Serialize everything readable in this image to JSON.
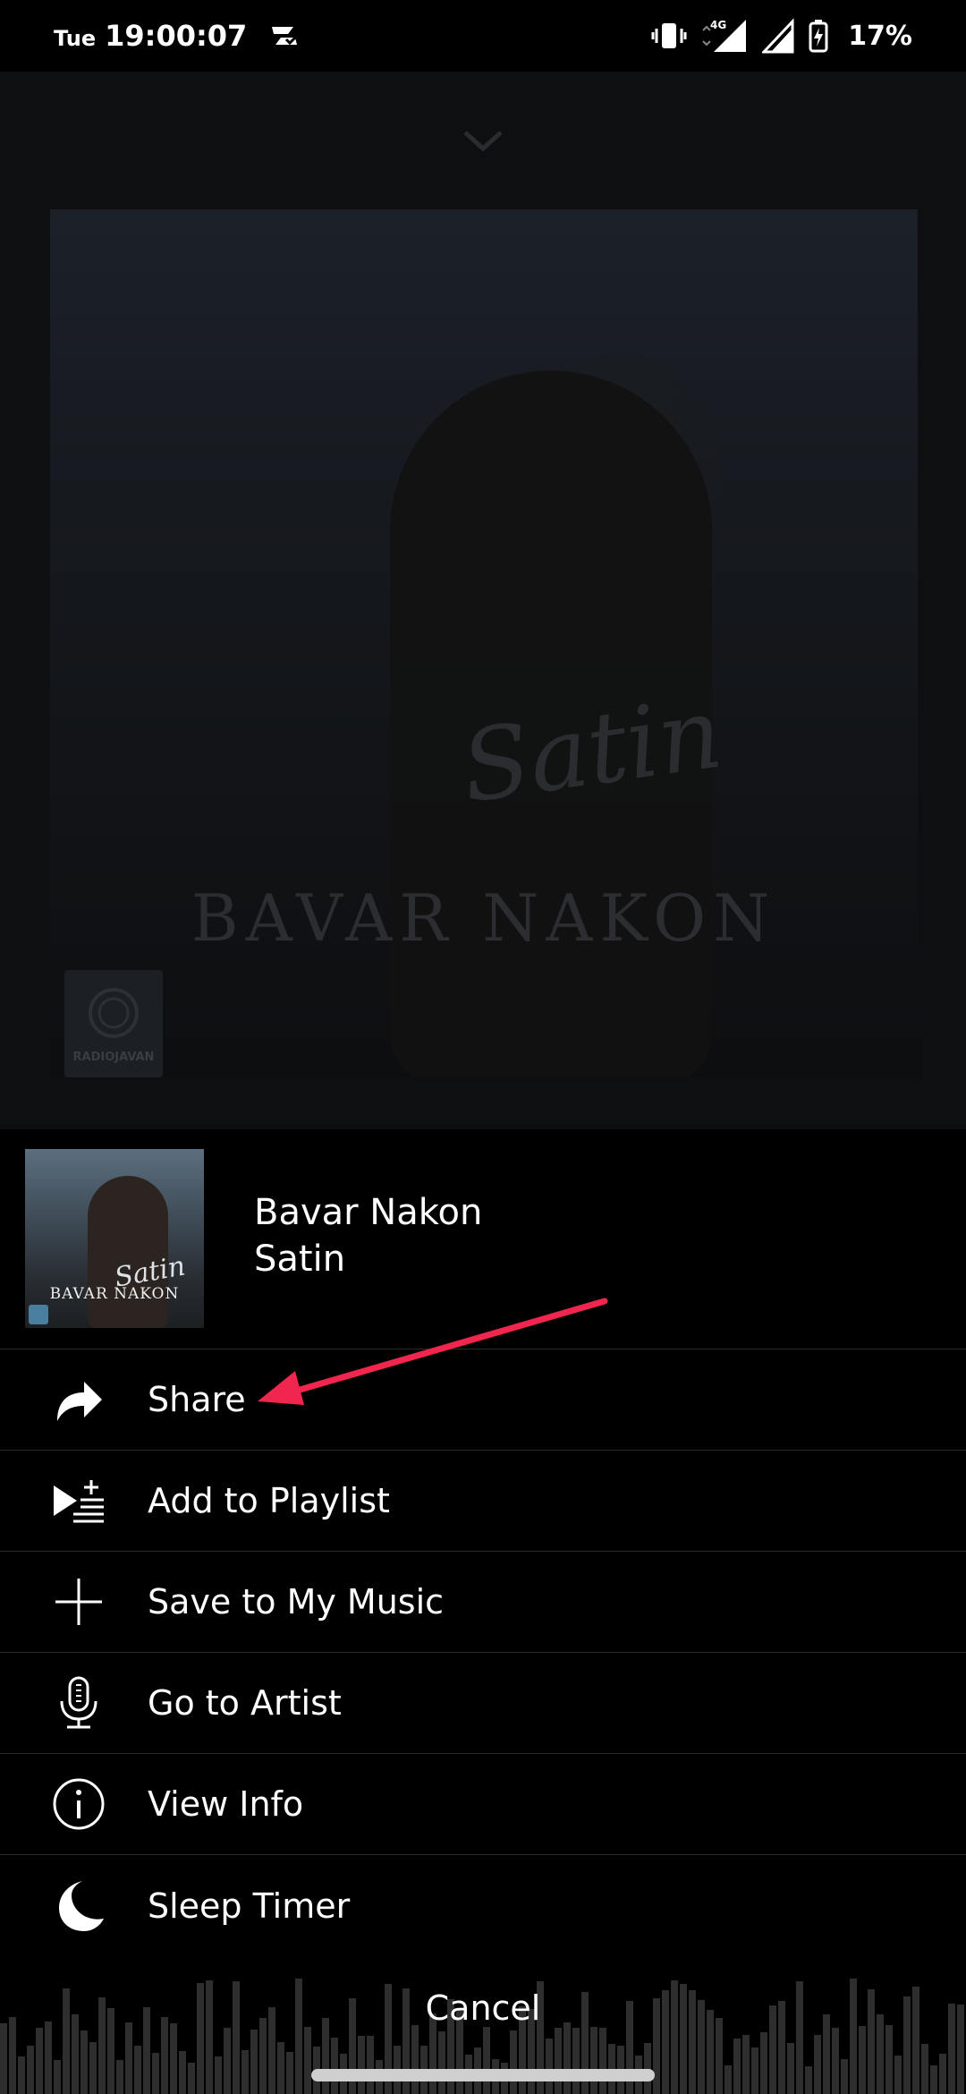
{
  "status_bar": {
    "day": "Tue",
    "time": "19:00:07",
    "network": "4G",
    "battery": "17%"
  },
  "album_art": {
    "script_title": "Satin",
    "title": "BAVAR NAKON",
    "logo_text": "RADIOJAVAN"
  },
  "now_playing": {
    "title": "Bavar Nakon",
    "artist": "Satin"
  },
  "menu": {
    "items": [
      {
        "label": "Share",
        "icon": "share-icon"
      },
      {
        "label": "Add to Playlist",
        "icon": "add-to-playlist-icon"
      },
      {
        "label": "Save to My Music",
        "icon": "plus-icon"
      },
      {
        "label": "Go to Artist",
        "icon": "microphone-icon"
      },
      {
        "label": "View Info",
        "icon": "info-icon"
      },
      {
        "label": "Sleep Timer",
        "icon": "moon-icon"
      }
    ]
  },
  "cancel_label": "Cancel",
  "colors": {
    "annotation_arrow": "#f0264f",
    "sheet_background": "#000000",
    "divider": "#2a2a2a"
  }
}
